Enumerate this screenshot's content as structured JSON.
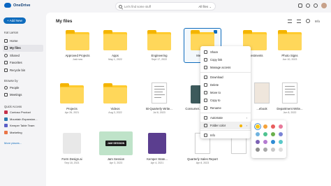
{
  "app": {
    "brand": "OneDrive"
  },
  "search": {
    "placeholder": "Let's find some stuff",
    "filter": "All files"
  },
  "sidebar": {
    "new_label": "+ Add New",
    "user": "Kat Larson",
    "items": [
      {
        "label": "Home"
      },
      {
        "label": "My files"
      },
      {
        "label": "Shared"
      },
      {
        "label": "Favorites"
      },
      {
        "label": "Recycle bin"
      }
    ],
    "browse_label": "Browse by",
    "browse_items": [
      {
        "label": "People"
      },
      {
        "label": "Meetings"
      }
    ],
    "quick_access_label": "Quick Access",
    "quick_access": [
      {
        "label": "Contoso Product",
        "color": "#c4314b"
      },
      {
        "label": "Mountain Expansion...",
        "color": "#2a7ab0"
      },
      {
        "label": "Kemper Table Team",
        "color": "#5b5fc7"
      },
      {
        "label": "Marketing",
        "color": "#e97548"
      }
    ],
    "more_places": "More places..."
  },
  "main": {
    "title": "My files",
    "info_label": "Info",
    "tiles": [
      {
        "name": "Approved Projects",
        "date": "Just now"
      },
      {
        "name": "Apps",
        "date": "May 1, 2022"
      },
      {
        "name": "Engineering",
        "date": "Sept 17, 2022"
      },
      {
        "name": "Meetings",
        "date": ""
      },
      {
        "name": "Investments",
        "date": ""
      },
      {
        "name": "Photo Signs",
        "date": "Jun 10, 2023"
      },
      {
        "name": "Projects",
        "date": "Apr 26, 2021"
      },
      {
        "name": "Videos",
        "date": "Aug 3, 2022"
      },
      {
        "name": "Bi-Quarterly Write...",
        "date": "Jul 8, 2023"
      },
      {
        "name": "Consumer...",
        "date": ""
      },
      {
        "name": "...ebook",
        "date": ""
      },
      {
        "name": "Department Write...",
        "date": "Jun 8, 2022"
      },
      {
        "name": "Form Design.ai",
        "date": "Sep 18, 2021"
      },
      {
        "name": "Jam Session",
        "date": "Apr 3, 2023"
      },
      {
        "name": "Kemper State...",
        "date": "Apr 4, 2021"
      },
      {
        "name": "",
        "date": ""
      },
      {
        "name": "Quarterly Sales Report",
        "date": "Apr 8, 2023"
      },
      {
        "name": "",
        "date": ""
      }
    ],
    "jam_label": "JAM SESSION"
  },
  "context_menu": {
    "items": [
      "Share",
      "Copy link",
      "Manage access",
      "Download",
      "Delete",
      "Move to",
      "Copy to",
      "Rename",
      "Automate",
      "Folder color",
      "Info"
    ]
  },
  "palette": {
    "colors": [
      "#f5c518",
      "#f4a23a",
      "#e85d5d",
      "#e8799a",
      "#6fb3e0",
      "#4fc38f",
      "#6ab04c",
      "#7b84d6",
      "#7b61b5",
      "#b57bd1",
      "#2e8bd4",
      "#5ac8c8",
      "#8d8d8d",
      "#a8a8a8",
      "#c8c8c8",
      "#dcdcdc"
    ]
  },
  "colors": {
    "accent": "#0f6cbd",
    "folder": "#ffcb2e"
  }
}
